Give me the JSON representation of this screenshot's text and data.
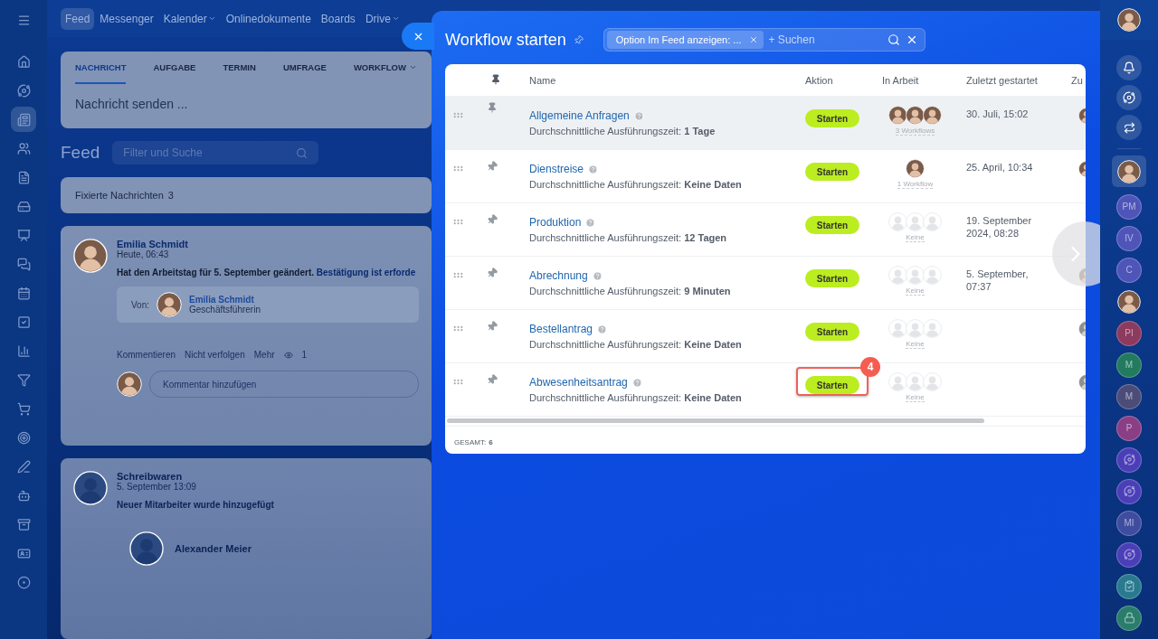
{
  "left_rail": {
    "items": [
      {
        "selected": false
      },
      {
        "selected": false
      },
      {
        "selected": true
      },
      {
        "selected": false
      },
      {
        "selected": false
      },
      {
        "selected": false
      },
      {
        "selected": false
      },
      {
        "selected": false
      },
      {
        "selected": false
      },
      {
        "selected": false
      },
      {
        "selected": false
      },
      {
        "selected": false
      },
      {
        "selected": false
      },
      {
        "selected": false
      },
      {
        "selected": false
      },
      {
        "selected": false
      },
      {
        "selected": false
      },
      {
        "selected": false
      },
      {
        "selected": false
      }
    ]
  },
  "top_nav": [
    {
      "label": "Feed",
      "selected": true,
      "dropdown": false
    },
    {
      "label": "Messenger",
      "selected": false,
      "dropdown": false
    },
    {
      "label": "Kalender",
      "selected": false,
      "dropdown": true
    },
    {
      "label": "Onlinedokumente",
      "selected": false,
      "dropdown": false
    },
    {
      "label": "Boards",
      "selected": false,
      "dropdown": false
    },
    {
      "label": "Drive",
      "selected": false,
      "dropdown": true
    }
  ],
  "composer": {
    "tabs": [
      {
        "label": "NACHRICHT",
        "selected": true,
        "dropdown": false
      },
      {
        "label": "AUFGABE",
        "selected": false,
        "dropdown": false
      },
      {
        "label": "TERMIN",
        "selected": false,
        "dropdown": false
      },
      {
        "label": "UMFRAGE",
        "selected": false,
        "dropdown": false
      },
      {
        "label": "WORKFLOW",
        "selected": false,
        "dropdown": true
      }
    ],
    "placeholder": "Nachricht senden ..."
  },
  "feed": {
    "title": "Feed",
    "search": {
      "placeholder": "Filter und Suche"
    },
    "pinned": {
      "label": "Fixierte Nachrichten",
      "count": "3"
    },
    "posts": [
      {
        "author": "Emilia Schmidt",
        "avatar": {
          "kind": "photo"
        },
        "time": "Heute, 06:43",
        "text": "Hat den Arbeitstag für 5. September geändert.",
        "link": "Bestätigung ist erforde",
        "from": {
          "label": "Von:",
          "name": "Emilia Schmidt",
          "role": "Geschäftsführerin"
        },
        "actions": [
          "Kommentieren",
          "Nicht verfolgen",
          "Mehr"
        ],
        "views": "1",
        "comment": {
          "placeholder": "Kommentar hinzufügen"
        }
      },
      {
        "author": "Schreibwaren",
        "avatar": {
          "kind": "generic"
        },
        "time": "5. September 13:09",
        "text": "Neuer Mitarbeiter wurde hinzugefügt",
        "employee": "Alexander Meier"
      }
    ]
  },
  "panel": {
    "title": "Workflow starten",
    "filter_chip": "Option Im Feed anzeigen: ...",
    "search": {
      "placeholder": "+ Suchen"
    },
    "table": {
      "columns": [
        "Name",
        "Aktion",
        "In Arbeit",
        "Zuletzt gestartet",
        "Zu"
      ],
      "rows": [
        {
          "name": "Allgemeine Anfragen",
          "pinned": true,
          "highlighted": true,
          "duration_label": "Durchschnittliche Ausführungszeit:",
          "duration": "1 Tage",
          "action": "Starten",
          "in_work": {
            "avatars": [
              {
                "kind": "photo"
              },
              {
                "kind": "photo"
              },
              {
                "kind": "photo"
              }
            ],
            "label": "3 Workflows"
          },
          "last_started": "30. Juli, 15:02",
          "column_6": {
            "kind": "photo"
          }
        },
        {
          "name": "Dienstreise",
          "pinned": false,
          "highlighted": false,
          "duration_label": "Durchschnittliche Ausführungszeit:",
          "duration": "Keine Daten",
          "action": "Starten",
          "in_work": {
            "avatars": [
              {
                "kind": "photo"
              }
            ],
            "label": "1 Workflow"
          },
          "last_started": "25. April, 10:34",
          "column_6": {
            "kind": "photo"
          }
        },
        {
          "name": "Produktion",
          "pinned": false,
          "highlighted": false,
          "duration_label": "Durchschnittliche Ausführungszeit:",
          "duration": "12 Tagen",
          "action": "Starten",
          "in_work": {
            "avatars": [
              {
                "kind": "empty"
              },
              {
                "kind": "empty"
              },
              {
                "kind": "empty"
              }
            ],
            "label": "Keine"
          },
          "last_started": "19. September 2024, 08:28"
        },
        {
          "name": "Abrechnung",
          "pinned": false,
          "highlighted": false,
          "duration_label": "Durchschnittliche Ausführungszeit:",
          "duration": "9 Minuten",
          "action": "Starten",
          "in_work": {
            "avatars": [
              {
                "kind": "empty"
              },
              {
                "kind": "empty"
              },
              {
                "kind": "empty"
              }
            ],
            "label": "Keine"
          },
          "last_started": "5. September, 07:37",
          "column_6": {
            "kind": "photo"
          }
        },
        {
          "name": "Bestellantrag",
          "pinned": false,
          "highlighted": false,
          "duration_label": "Durchschnittliche Ausführungszeit:",
          "duration": "Keine Daten",
          "action": "Starten",
          "in_work": {
            "avatars": [
              {
                "kind": "empty"
              },
              {
                "kind": "empty"
              },
              {
                "kind": "empty"
              }
            ],
            "label": "Keine"
          },
          "column_6": {
            "kind": "grey"
          }
        },
        {
          "name": "Abwesenheitsantrag",
          "pinned": false,
          "highlighted": false,
          "duration_label": "Durchschnittliche Ausführungszeit:",
          "duration": "Keine Daten",
          "action": "Starten",
          "callout": "4",
          "in_work": {
            "avatars": [
              {
                "kind": "empty"
              },
              {
                "kind": "empty"
              },
              {
                "kind": "empty"
              }
            ],
            "label": "Keine"
          },
          "column_6": {
            "kind": "grey"
          }
        }
      ],
      "total_label": "GESAMT:",
      "total": "6"
    }
  },
  "right_bar": {
    "chats": [
      {
        "kind": "photo",
        "selected": true
      },
      {
        "kind": "initials",
        "initials": "PM",
        "color": "#4f55b8",
        "selected": false
      },
      {
        "kind": "initials",
        "initials": "IV",
        "color": "#4f55b8",
        "selected": false
      },
      {
        "kind": "initials",
        "initials": "C",
        "color": "#4f55b8",
        "selected": false
      },
      {
        "kind": "photo",
        "selected": false
      },
      {
        "kind": "initials",
        "initials": "PI",
        "color": "#8c3a5e",
        "selected": false
      },
      {
        "kind": "initials",
        "initials": "M",
        "color": "#237a5e",
        "selected": false
      },
      {
        "kind": "initials",
        "initials": "M",
        "color": "#4c4c78",
        "selected": false
      },
      {
        "kind": "initials",
        "initials": "P",
        "color": "#8a3f85",
        "selected": false
      },
      {
        "kind": "assistant",
        "color": "#4b3fb8",
        "selected": false
      },
      {
        "kind": "assistant",
        "color": "#4b3fb8",
        "selected": false
      },
      {
        "kind": "initials",
        "initials": "MI",
        "color": "#3f4ca0",
        "selected": false
      },
      {
        "kind": "assistant",
        "color": "#4b3fb8",
        "selected": false
      },
      {
        "kind": "tasks",
        "color": "#2a7a8f",
        "selected": false
      },
      {
        "kind": "lock",
        "color": "#2a7d6a",
        "selected": false
      }
    ]
  }
}
